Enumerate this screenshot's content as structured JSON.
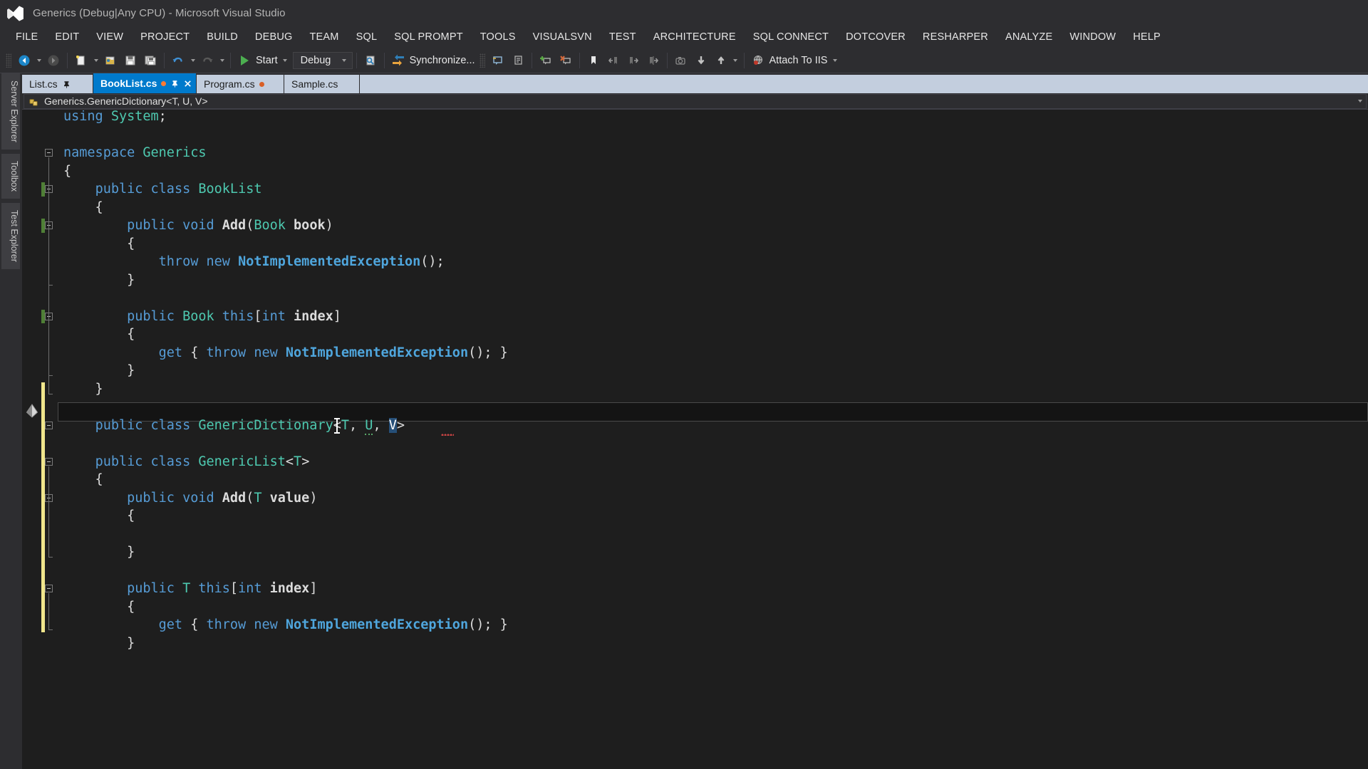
{
  "window": {
    "title": "Generics (Debug|Any CPU) - Microsoft Visual Studio",
    "logo_icon": "visual-studio-logo-icon"
  },
  "menubar": {
    "items": [
      {
        "label": "FILE"
      },
      {
        "label": "EDIT"
      },
      {
        "label": "VIEW"
      },
      {
        "label": "PROJECT"
      },
      {
        "label": "BUILD"
      },
      {
        "label": "DEBUG"
      },
      {
        "label": "TEAM"
      },
      {
        "label": "SQL"
      },
      {
        "label": "SQL PROMPT"
      },
      {
        "label": "TOOLS"
      },
      {
        "label": "VISUALSVN"
      },
      {
        "label": "TEST"
      },
      {
        "label": "ARCHITECTURE"
      },
      {
        "label": "SQL CONNECT"
      },
      {
        "label": "DOTCOVER"
      },
      {
        "label": "RESHARPER"
      },
      {
        "label": "ANALYZE"
      },
      {
        "label": "WINDOW"
      },
      {
        "label": "HELP"
      }
    ]
  },
  "toolbar": {
    "navigate_back_icon": "navigate-back-icon",
    "navigate_forward_icon": "navigate-forward-icon",
    "new_project_icon": "new-project-icon",
    "open_file_icon": "open-file-icon",
    "save_icon": "save-icon",
    "save_all_icon": "save-all-icon",
    "undo_icon": "undo-icon",
    "redo_icon": "redo-icon",
    "start_label": "Start",
    "start_icon": "play-icon",
    "config_value": "Debug",
    "find_icon": "find-in-files-icon",
    "synchronize_label": "Synchronize...",
    "synchronize_icon": "synchronize-icon",
    "comment_icon": "comment-selection-icon",
    "uncomment_icon": "uncomment-selection-icon",
    "add_bookmark_icon": "add-comment-icon",
    "remove_bookmark_icon": "remove-comment-icon",
    "toggle_bookmark_icon": "toggle-bookmark-icon",
    "prev_bookmark_icon": "previous-bookmark-icon",
    "next_bookmark_icon": "next-bookmark-icon",
    "clear_bookmarks_icon": "clear-bookmarks-icon",
    "snapshot_icon": "snapshot-icon",
    "step_down_icon": "step-down-icon",
    "step_up_icon": "step-up-icon",
    "attach_iis_label": "Attach To IIS",
    "attach_iis_icon": "attach-to-iis-icon",
    "overflow_icon": "toolbar-overflow-icon"
  },
  "leftdock": {
    "tabs": [
      {
        "label": "Server Explorer"
      },
      {
        "label": "Toolbox"
      },
      {
        "label": "Test Explorer"
      }
    ]
  },
  "tabstrip": {
    "tabs": [
      {
        "label": "List.cs",
        "active": false,
        "dirty": false,
        "pinned": true
      },
      {
        "label": "BookList.cs",
        "active": true,
        "dirty": true,
        "pinned": true
      },
      {
        "label": "Program.cs",
        "active": false,
        "dirty": true,
        "pinned": false
      },
      {
        "label": "Sample.cs",
        "active": false,
        "dirty": false,
        "pinned": false
      }
    ],
    "pin_icon": "pin-icon",
    "close_icon": "close-icon"
  },
  "navbar": {
    "class_icon": "class-symbol-icon",
    "breadcrumb": "Generics.GenericDictionary<T, U, V>",
    "dropdown_icon": "chevron-down-icon"
  },
  "editor": {
    "suggestion_icon": "lightbulb-suggestion-icon",
    "current_line_text": "public class GenericDictionary<T, U, V>",
    "selected_text": "V",
    "code_lines": [
      "using System;",
      "",
      "namespace Generics",
      "{",
      "    public class BookList",
      "    {",
      "        public void Add(Book book)",
      "        {",
      "            throw new NotImplementedException();",
      "        }",
      "",
      "        public Book this[int index]",
      "        {",
      "            get { throw new NotImplementedException(); }",
      "        }",
      "    }",
      "",
      "    public class GenericDictionary<T, U, V>",
      "",
      "    public class GenericList<T>",
      "    {",
      "        public void Add(T value)",
      "        {",
      "",
      "        }",
      "",
      "        public T this[int index]",
      "        {",
      "            get { throw new NotImplementedException(); }",
      "        }"
    ]
  },
  "colors": {
    "accent": "#007acc",
    "chrome": "#2d2d30",
    "editor_bg": "#1e1e1e",
    "keyword": "#569cd6",
    "type": "#4ec9b0",
    "exception": "#4fa6dd",
    "text": "#dcdcdc",
    "selection": "#264f78",
    "saved_change_bar": "#4f7f36",
    "unsaved_change_bar": "#f0e68c",
    "dirty_dot": "#d95f26"
  }
}
